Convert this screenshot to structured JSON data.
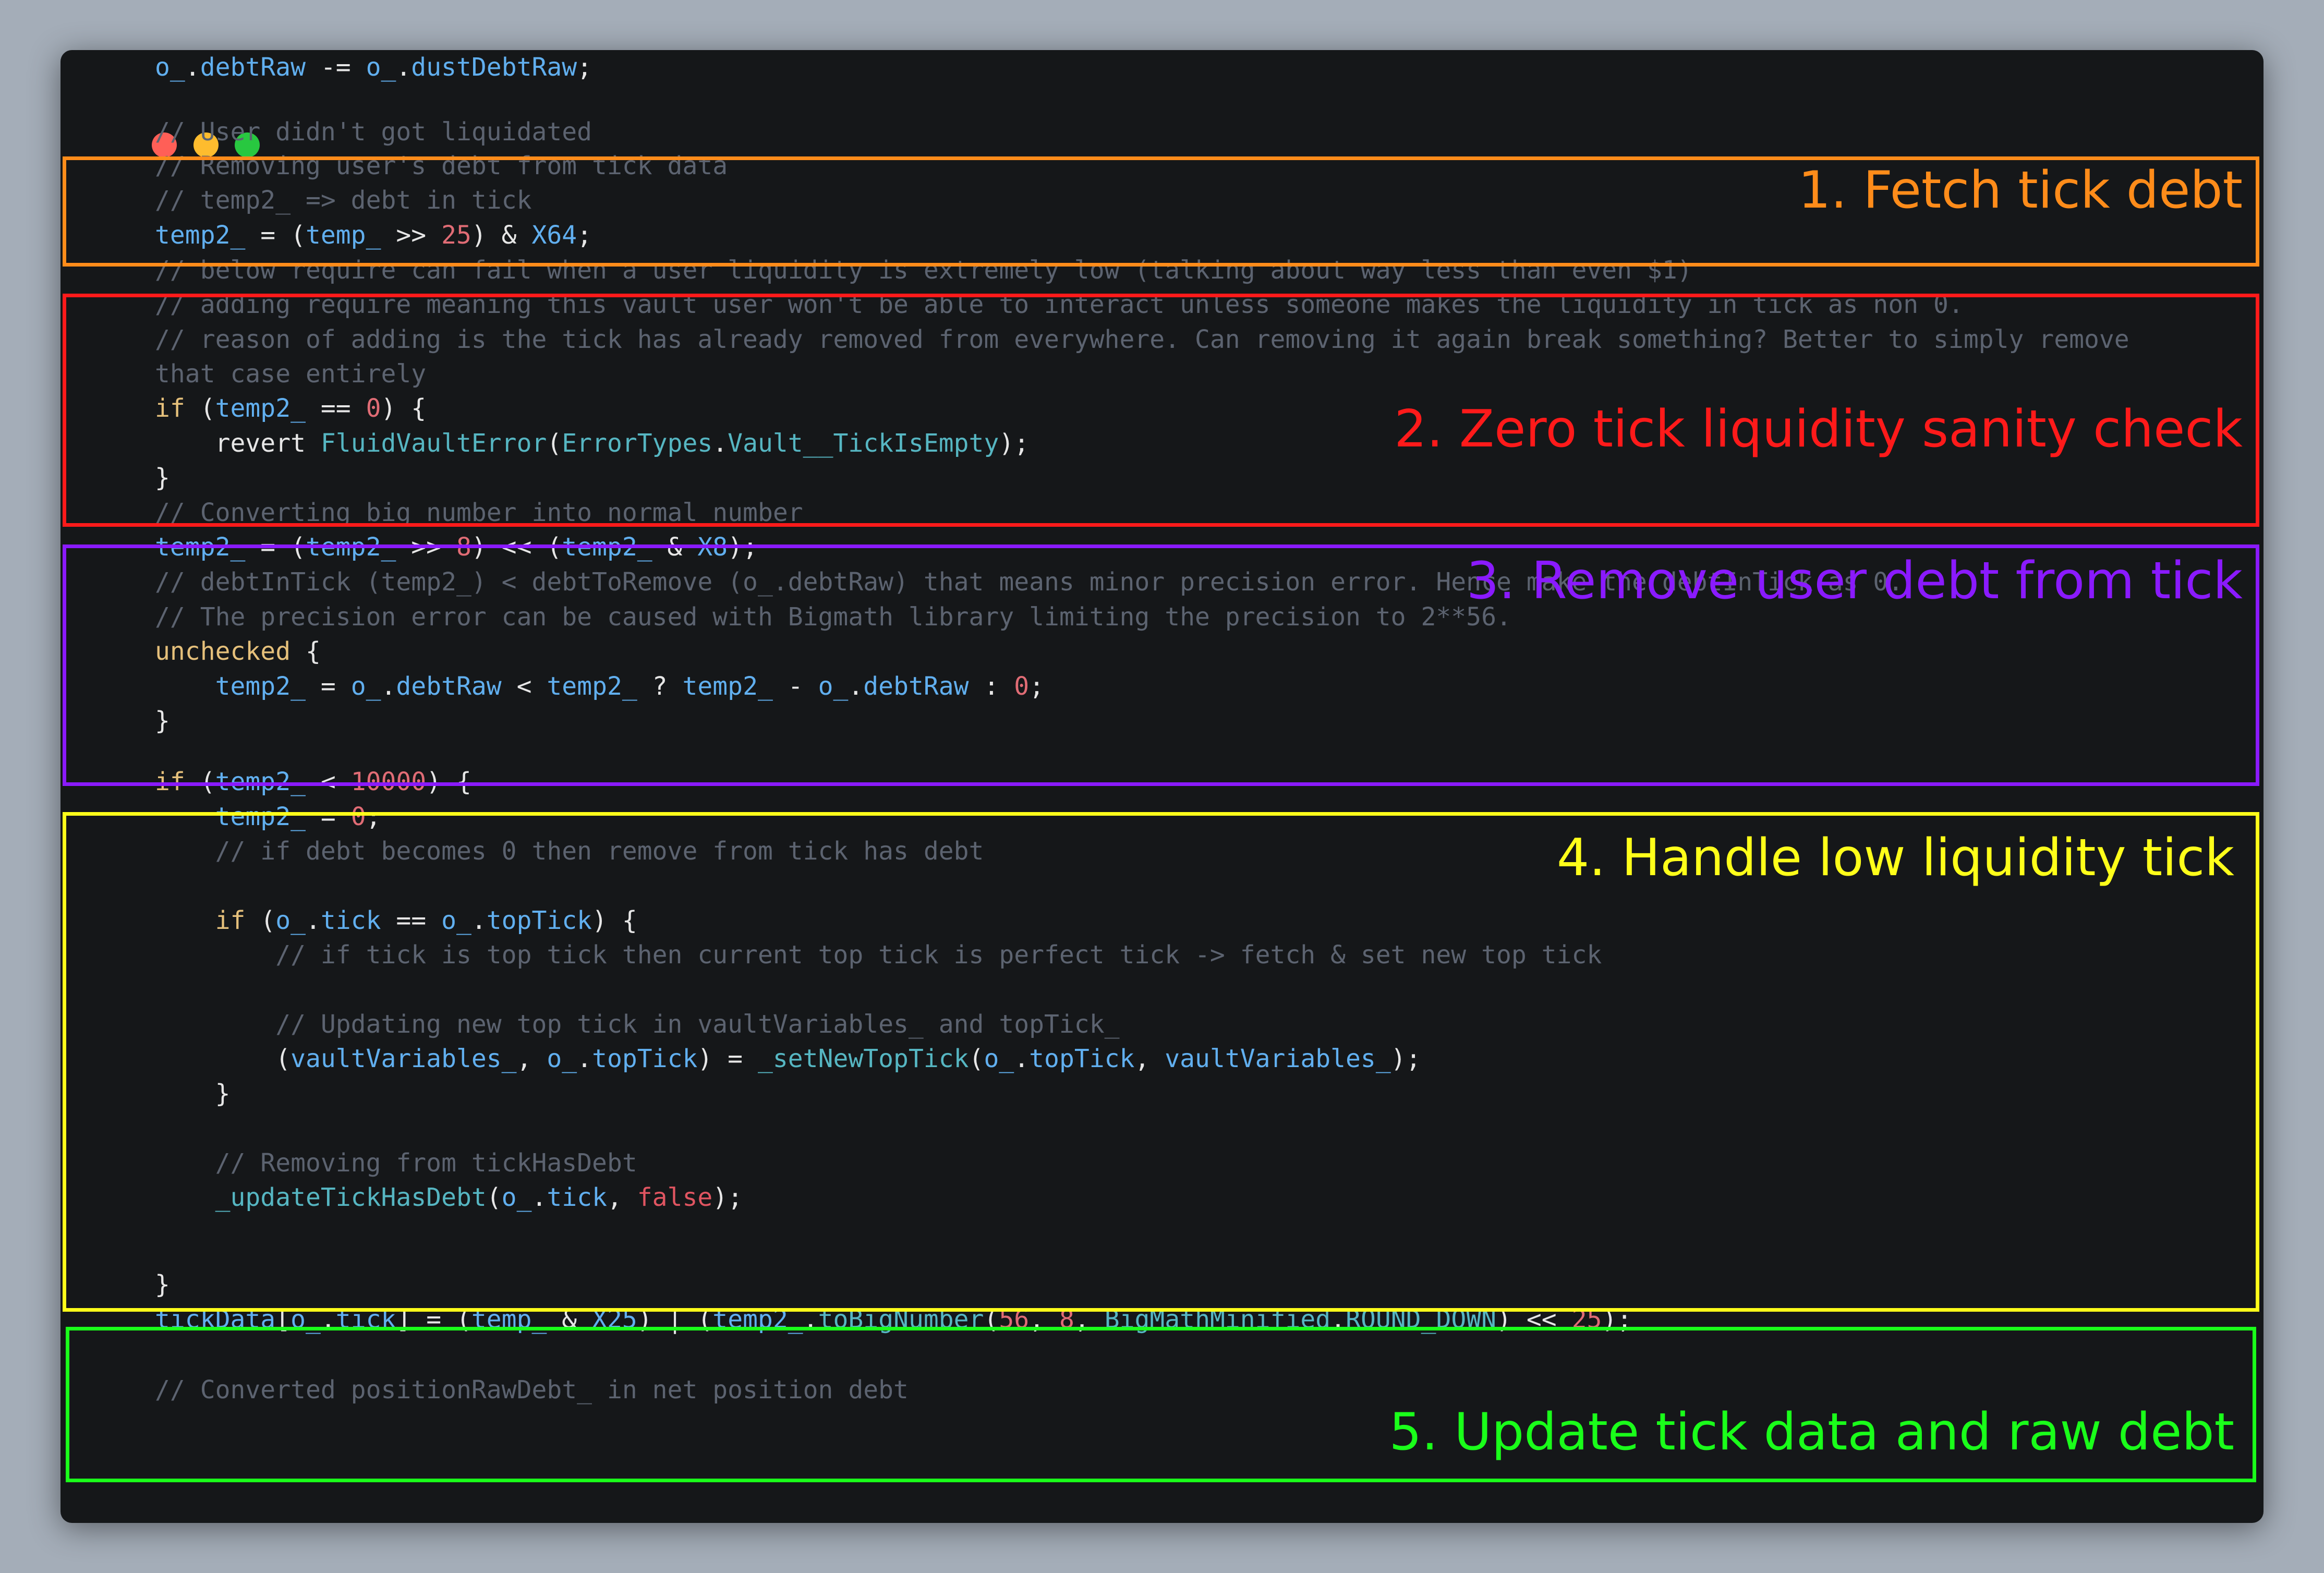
{
  "window": {
    "controls": [
      "close",
      "minimize",
      "maximize"
    ],
    "colors": {
      "background": "#151719",
      "close": "#ff5f57",
      "minimize": "#febc2e",
      "maximize": "#28c840"
    }
  },
  "sections": [
    {
      "label": "1. Fetch tick debt",
      "color": "#ff8c1a"
    },
    {
      "label": "2. Zero tick liquidity sanity check",
      "color": "#ff1a1a"
    },
    {
      "label": "3. Remove user debt from tick",
      "color": "#8a1aff"
    },
    {
      "label": "4. Handle low liquidity tick",
      "color": "#ffff1a"
    },
    {
      "label": "5. Update tick data and raw debt",
      "color": "#1aff1a"
    }
  ],
  "code": [
    [
      [
        "c",
        "// User didn't got liquidated"
      ]
    ],
    [
      [
        "c",
        "// Removing user's debt from tick data"
      ]
    ],
    [
      [
        "c",
        "// temp2_ => debt in tick"
      ]
    ],
    [
      [
        "v",
        "temp2_"
      ],
      [
        "p",
        " = ("
      ],
      [
        "v",
        "temp_"
      ],
      [
        "p",
        " >> "
      ],
      [
        "n",
        "25"
      ],
      [
        "p",
        ") & "
      ],
      [
        "v",
        "X64"
      ],
      [
        "p",
        ";"
      ]
    ],
    [
      [
        "c",
        "// below require can fail when a user liquidity is extremely low (talking about way less than even $1)"
      ]
    ],
    [
      [
        "c",
        "// adding require meaning this vault user won't be able to interact unless someone makes the liquidity in tick as non 0."
      ]
    ],
    [
      [
        "c",
        "// reason of adding is the tick has already removed from everywhere. Can removing it again break something? Better to simply remove"
      ]
    ],
    [
      [
        "c",
        "that case entirely"
      ]
    ],
    [
      [
        "k",
        "if"
      ],
      [
        "p",
        " ("
      ],
      [
        "v",
        "temp2_"
      ],
      [
        "p",
        " == "
      ],
      [
        "n",
        "0"
      ],
      [
        "p",
        ") {"
      ]
    ],
    [
      [
        "p",
        "    revert "
      ],
      [
        "f",
        "FluidVaultError"
      ],
      [
        "p",
        "("
      ],
      [
        "f",
        "ErrorTypes"
      ],
      [
        "p",
        "."
      ],
      [
        "f",
        "Vault__TickIsEmpty"
      ],
      [
        "p",
        ");"
      ]
    ],
    [
      [
        "p",
        "}"
      ]
    ],
    [
      [
        "c",
        "// Converting big number into normal number"
      ]
    ],
    [
      [
        "v",
        "temp2_"
      ],
      [
        "p",
        " = ("
      ],
      [
        "v",
        "temp2_"
      ],
      [
        "p",
        " >> "
      ],
      [
        "n",
        "8"
      ],
      [
        "p",
        ") << ("
      ],
      [
        "v",
        "temp2_"
      ],
      [
        "p",
        " & "
      ],
      [
        "v",
        "X8"
      ],
      [
        "p",
        ");"
      ]
    ],
    [
      [
        "c",
        "// debtInTick (temp2_) < debtToRemove (o_.debtRaw) that means minor precision error. Hence make the debtInTick as 0."
      ]
    ],
    [
      [
        "c",
        "// The precision error can be caused with Bigmath library limiting the precision to 2**56."
      ]
    ],
    [
      [
        "k",
        "unchecked"
      ],
      [
        "p",
        " {"
      ]
    ],
    [
      [
        "p",
        "    "
      ],
      [
        "v",
        "temp2_"
      ],
      [
        "p",
        " = "
      ],
      [
        "v",
        "o_"
      ],
      [
        "p",
        "."
      ],
      [
        "v",
        "debtRaw"
      ],
      [
        "p",
        " < "
      ],
      [
        "v",
        "temp2_"
      ],
      [
        "p",
        " ? "
      ],
      [
        "v",
        "temp2_"
      ],
      [
        "p",
        " - "
      ],
      [
        "v",
        "o_"
      ],
      [
        "p",
        "."
      ],
      [
        "v",
        "debtRaw"
      ],
      [
        "p",
        " : "
      ],
      [
        "n",
        "0"
      ],
      [
        "p",
        ";"
      ]
    ],
    [
      [
        "p",
        "}"
      ]
    ],
    [
      [
        "k",
        "if"
      ],
      [
        "p",
        " ("
      ],
      [
        "v",
        "temp2_"
      ],
      [
        "p",
        " < "
      ],
      [
        "n",
        "10000"
      ],
      [
        "p",
        ") {"
      ]
    ],
    [
      [
        "p",
        "    "
      ],
      [
        "v",
        "temp2_"
      ],
      [
        "p",
        " = "
      ],
      [
        "n",
        "0"
      ],
      [
        "p",
        ";"
      ]
    ],
    [
      [
        "c",
        "    // if debt becomes 0 then remove from tick has debt"
      ]
    ],
    [
      [
        "p",
        ""
      ]
    ],
    [
      [
        "p",
        "    "
      ],
      [
        "k",
        "if"
      ],
      [
        "p",
        " ("
      ],
      [
        "v",
        "o_"
      ],
      [
        "p",
        "."
      ],
      [
        "v",
        "tick"
      ],
      [
        "p",
        " == "
      ],
      [
        "v",
        "o_"
      ],
      [
        "p",
        "."
      ],
      [
        "v",
        "topTick"
      ],
      [
        "p",
        ") {"
      ]
    ],
    [
      [
        "c",
        "        // if tick is top tick then current top tick is perfect tick -> fetch & set new top tick"
      ]
    ],
    [
      [
        "p",
        ""
      ]
    ],
    [
      [
        "c",
        "        // Updating new top tick in vaultVariables_ and topTick_"
      ]
    ],
    [
      [
        "p",
        "        ("
      ],
      [
        "v",
        "vaultVariables_"
      ],
      [
        "p",
        ", "
      ],
      [
        "v",
        "o_"
      ],
      [
        "p",
        "."
      ],
      [
        "v",
        "topTick"
      ],
      [
        "p",
        ") = "
      ],
      [
        "f",
        "_setNewTopTick"
      ],
      [
        "p",
        "("
      ],
      [
        "v",
        "o_"
      ],
      [
        "p",
        "."
      ],
      [
        "v",
        "topTick"
      ],
      [
        "p",
        ", "
      ],
      [
        "v",
        "vaultVariables_"
      ],
      [
        "p",
        ");"
      ]
    ],
    [
      [
        "p",
        "    }"
      ]
    ],
    [
      [
        "p",
        ""
      ]
    ],
    [
      [
        "c",
        "    // Removing from tickHasDebt"
      ]
    ],
    [
      [
        "p",
        "    "
      ],
      [
        "f",
        "_updateTickHasDebt"
      ],
      [
        "p",
        "("
      ],
      [
        "v",
        "o_"
      ],
      [
        "p",
        "."
      ],
      [
        "v",
        "tick"
      ],
      [
        "p",
        ", "
      ],
      [
        "red-kw",
        "false"
      ],
      [
        "p",
        ");"
      ]
    ],
    [
      [
        "p",
        "}"
      ]
    ],
    [
      [
        "v",
        "tickData"
      ],
      [
        "p",
        "["
      ],
      [
        "v",
        "o_"
      ],
      [
        "p",
        "."
      ],
      [
        "v",
        "tick"
      ],
      [
        "p",
        "] = ("
      ],
      [
        "v",
        "temp_"
      ],
      [
        "p",
        " & "
      ],
      [
        "v",
        "X25"
      ],
      [
        "p",
        ") | ("
      ],
      [
        "v",
        "temp2_"
      ],
      [
        "p",
        "."
      ],
      [
        "f",
        "toBigNumber"
      ],
      [
        "p",
        "("
      ],
      [
        "n",
        "56"
      ],
      [
        "p",
        ", "
      ],
      [
        "n",
        "8"
      ],
      [
        "p",
        ", "
      ],
      [
        "f",
        "BigMathMinified"
      ],
      [
        "p",
        "."
      ],
      [
        "f",
        "ROUND_DOWN"
      ],
      [
        "p",
        ") << "
      ],
      [
        "n",
        "25"
      ],
      [
        "p",
        ");"
      ]
    ],
    [
      [
        "p",
        ""
      ]
    ],
    [
      [
        "c",
        "// Converted positionRawDebt_ in net position debt"
      ]
    ],
    [
      [
        "v",
        "o_"
      ],
      [
        "p",
        "."
      ],
      [
        "v",
        "debtRaw"
      ],
      [
        "p",
        " -= "
      ],
      [
        "v",
        "o_"
      ],
      [
        "p",
        "."
      ],
      [
        "v",
        "dustDebtRaw"
      ],
      [
        "p",
        ";"
      ]
    ]
  ]
}
